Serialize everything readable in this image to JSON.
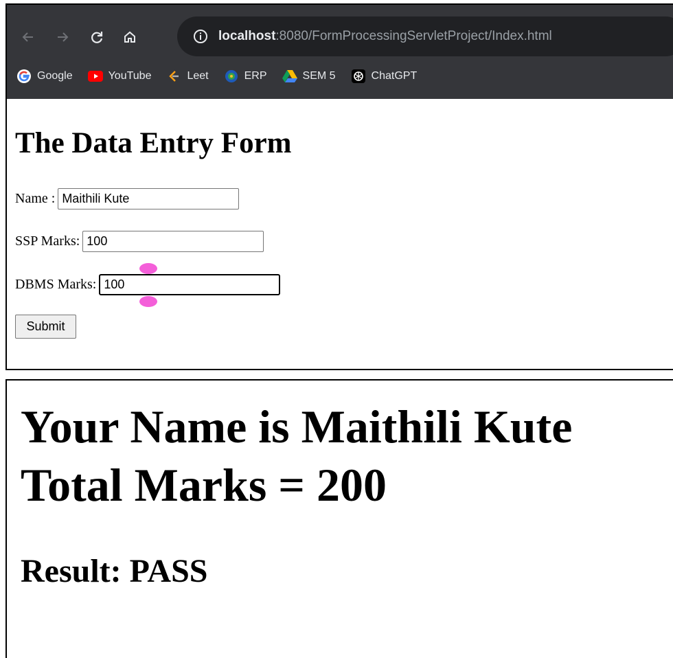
{
  "browser": {
    "url_host": "localhost",
    "url_path": ":8080/FormProcessingServletProject/Index.html",
    "bookmarks": [
      {
        "label": "Google",
        "icon": "google-icon"
      },
      {
        "label": "YouTube",
        "icon": "youtube-icon"
      },
      {
        "label": "Leet",
        "icon": "leetcode-icon"
      },
      {
        "label": "ERP",
        "icon": "erp-icon"
      },
      {
        "label": "SEM 5",
        "icon": "google-drive-icon"
      },
      {
        "label": "ChatGPT",
        "icon": "chatgpt-icon"
      }
    ]
  },
  "form": {
    "title": "The Data Entry Form",
    "name_label": "Name :",
    "name_value": "Maithili Kute",
    "ssp_label": "SSP Marks:",
    "ssp_value": "100",
    "dbms_label": "DBMS Marks:",
    "dbms_value": "100",
    "submit_label": "Submit"
  },
  "result": {
    "name_line": "Your Name is Maithili Kute",
    "total_line": "Total Marks = 200",
    "result_line": "Result: PASS"
  },
  "colors": {
    "toolbar_bg": "#35363a",
    "omnibox_bg": "#202124",
    "selection_handle": "#f45fd9"
  }
}
